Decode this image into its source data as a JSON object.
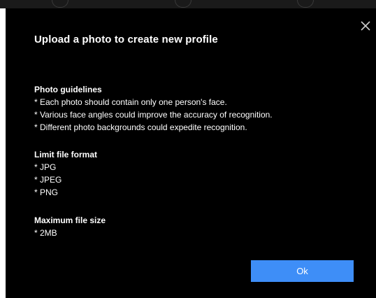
{
  "dialog": {
    "title": "Upload a photo to create new profile",
    "close_icon": "close-icon",
    "sections": [
      {
        "heading": "Photo guidelines",
        "items": [
          "* Each photo should contain only one person's face.",
          "* Various face angles could improve the accuracy of recognition.",
          "* Different photo backgrounds could expedite recognition."
        ]
      },
      {
        "heading": "Limit file format",
        "items": [
          "* JPG",
          "* JPEG",
          "* PNG"
        ]
      },
      {
        "heading": "Maximum file size",
        "items": [
          "* 2MB"
        ]
      }
    ],
    "ok_label": "Ok"
  },
  "colors": {
    "dialog_background": "#000000",
    "text": "#ffffff",
    "accent": "#3e8ef7"
  }
}
